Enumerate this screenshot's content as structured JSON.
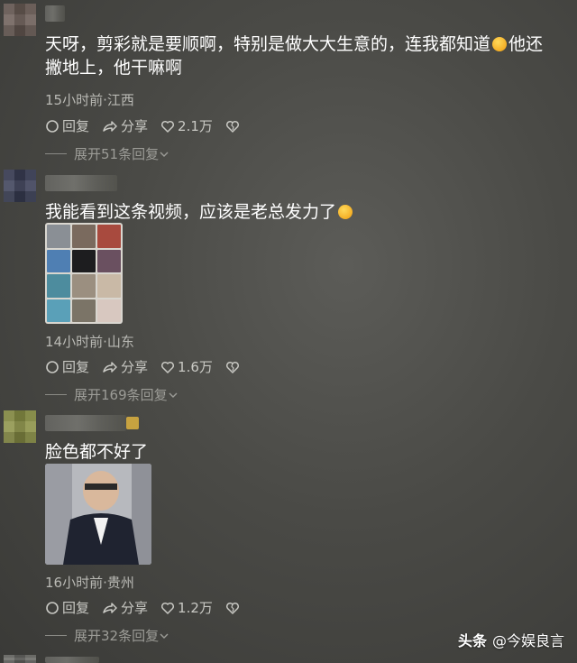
{
  "comments": [
    {
      "lines": [
        "天呀，剪彩就是要顺啊，特别是做大大生意的，连我都知道",
        "他还",
        "撇地上，他干嘛啊"
      ],
      "meta": "15小时前·江西",
      "reply_label": "回复",
      "share_label": "分享",
      "likes": "2.1万",
      "expand_label": "展开51条回复"
    },
    {
      "lines": [
        "我能看到这条视频，应该是老总发力了"
      ],
      "meta": "14小时前·山东",
      "reply_label": "回复",
      "share_label": "分享",
      "likes": "1.6万",
      "expand_label": "展开169条回复"
    },
    {
      "lines": [
        "脸色都不好了"
      ],
      "meta": "16小时前·贵州",
      "reply_label": "回复",
      "share_label": "分享",
      "likes": "1.2万",
      "expand_label": "展开32条回复"
    }
  ],
  "watermark": {
    "brand": "头条",
    "handle": "@今娱良言"
  },
  "icons": {
    "reply": "comment-bubble-icon",
    "share": "share-arrow-icon",
    "like": "heart-icon",
    "dislike": "broken-heart-icon",
    "expand": "chevron-down-icon"
  }
}
